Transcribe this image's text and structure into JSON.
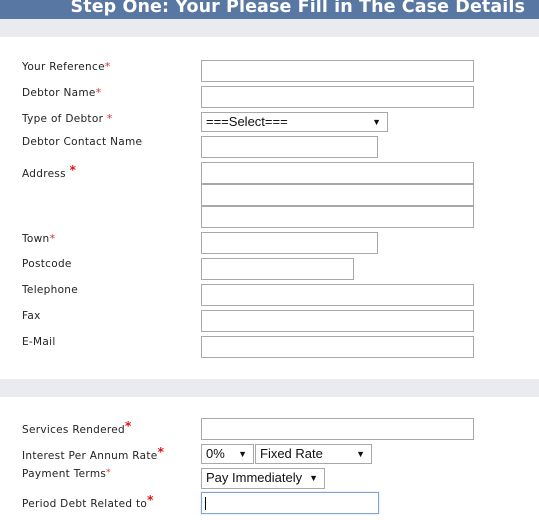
{
  "header": {
    "title": "Step One: Your Please Fill in The Case Details"
  },
  "section1": {
    "fields": {
      "your_reference": {
        "label": "Your Reference",
        "required_mark": "*",
        "value": ""
      },
      "debtor_name": {
        "label": "Debtor Name",
        "required_mark": "*",
        "value": ""
      },
      "type_of_debtor": {
        "label": "Type of Debtor ",
        "required_mark": "*",
        "selected": "===Select==="
      },
      "debtor_contact_name": {
        "label": "Debtor Contact Name",
        "value": ""
      },
      "address": {
        "label": "Address ",
        "required_mark": "*",
        "lines": [
          "",
          "",
          ""
        ]
      },
      "town": {
        "label": "Town",
        "required_mark": "*",
        "value": ""
      },
      "postcode": {
        "label": "Postcode",
        "value": ""
      },
      "telephone": {
        "label": "Telephone",
        "value": ""
      },
      "fax": {
        "label": "Fax",
        "value": ""
      },
      "email": {
        "label": "E-Mail",
        "value": ""
      }
    }
  },
  "section2": {
    "fields": {
      "services_rendered": {
        "label": "Services Rendered",
        "required_mark": "*",
        "value": ""
      },
      "interest_rate": {
        "label": "Interest Per Annum Rate",
        "required_mark": "*",
        "rate_selected": "0%",
        "type_selected": "Fixed Rate"
      },
      "payment_terms": {
        "label": "Payment Terms",
        "required_mark": "*",
        "selected": "Pay Immediately"
      },
      "period_debt": {
        "label": "Period Debt Related to",
        "required_mark": "*",
        "value": ""
      }
    }
  },
  "icons": {
    "dropdown_arrow": "▼"
  },
  "colors": {
    "header_bg": "#5877a2",
    "band_bg": "#e9ebef",
    "required": "#e03030",
    "focus_border": "#7fa3d6"
  }
}
